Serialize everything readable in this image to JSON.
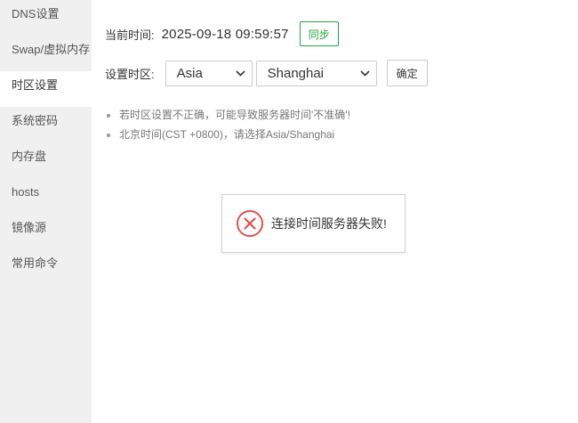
{
  "sidebar": {
    "items": [
      {
        "label": "DNS设置",
        "active": false
      },
      {
        "label": "Swap/虚拟内存",
        "active": false
      },
      {
        "label": "时区设置",
        "active": true
      },
      {
        "label": "系统密码",
        "active": false
      },
      {
        "label": "内存盘",
        "active": false
      },
      {
        "label": "hosts",
        "active": false
      },
      {
        "label": "镜像源",
        "active": false
      },
      {
        "label": "常用命令",
        "active": false
      }
    ]
  },
  "time": {
    "label": "当前时间:",
    "value": "2025-09-18 09:59:57",
    "sync_label": "同步"
  },
  "timezone": {
    "label": "设置时区:",
    "region": "Asia",
    "city": "Shanghai",
    "confirm_label": "确定"
  },
  "tips": [
    "若时区设置不正确，可能导致服务器时间'不准确'!",
    "北京时间(CST +0800)，请选择Asia/Shanghai"
  ],
  "toast": {
    "message": "连接时间服务器失败!",
    "icon": "error-circle-icon"
  },
  "colors": {
    "accent": "#20a53a",
    "error": "#e2504b",
    "sidebar_bg": "#f0f0f0"
  }
}
